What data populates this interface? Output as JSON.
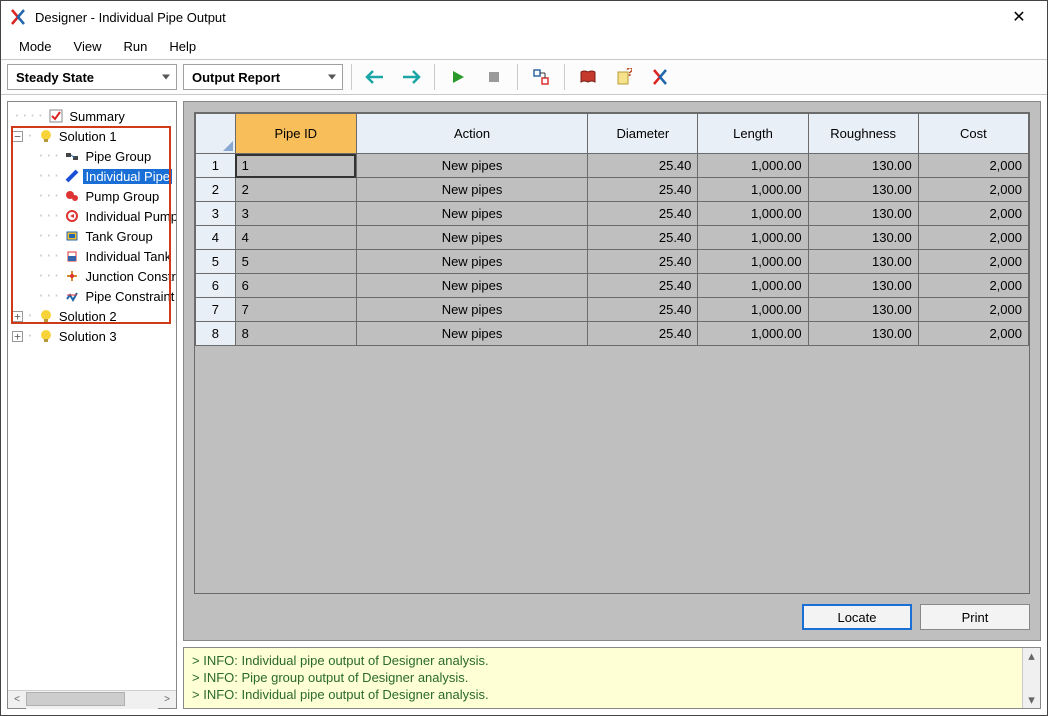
{
  "window": {
    "title": "Designer - Individual Pipe Output"
  },
  "menu": {
    "items": [
      "Mode",
      "View",
      "Run",
      "Help"
    ]
  },
  "toolbar": {
    "mode_combo": "Steady State",
    "report_combo": "Output Report"
  },
  "tree": {
    "summary": "Summary",
    "solution1": "Solution 1",
    "solution2": "Solution 2",
    "solution3": "Solution 3",
    "children": {
      "pipe_group": "Pipe Group",
      "individual_pipe": "Individual Pipe",
      "pump_group": "Pump Group",
      "individual_pump": "Individual Pump",
      "tank_group": "Tank Group",
      "individual_tank": "Individual Tank",
      "junction_con": "Junction Constraint",
      "pipe_constraint": "Pipe Constraint"
    }
  },
  "table": {
    "headers": {
      "pipe_id": "Pipe ID",
      "action": "Action",
      "diameter": "Diameter",
      "length": "Length",
      "roughness": "Roughness",
      "cost": "Cost"
    },
    "rows": [
      {
        "n": "1",
        "id": "1",
        "action": "New pipes",
        "diameter": "25.40",
        "length": "1,000.00",
        "roughness": "130.00",
        "cost": "2,000"
      },
      {
        "n": "2",
        "id": "2",
        "action": "New pipes",
        "diameter": "25.40",
        "length": "1,000.00",
        "roughness": "130.00",
        "cost": "2,000"
      },
      {
        "n": "3",
        "id": "3",
        "action": "New pipes",
        "diameter": "25.40",
        "length": "1,000.00",
        "roughness": "130.00",
        "cost": "2,000"
      },
      {
        "n": "4",
        "id": "4",
        "action": "New pipes",
        "diameter": "25.40",
        "length": "1,000.00",
        "roughness": "130.00",
        "cost": "2,000"
      },
      {
        "n": "5",
        "id": "5",
        "action": "New pipes",
        "diameter": "25.40",
        "length": "1,000.00",
        "roughness": "130.00",
        "cost": "2,000"
      },
      {
        "n": "6",
        "id": "6",
        "action": "New pipes",
        "diameter": "25.40",
        "length": "1,000.00",
        "roughness": "130.00",
        "cost": "2,000"
      },
      {
        "n": "7",
        "id": "7",
        "action": "New pipes",
        "diameter": "25.40",
        "length": "1,000.00",
        "roughness": "130.00",
        "cost": "2,000"
      },
      {
        "n": "8",
        "id": "8",
        "action": "New pipes",
        "diameter": "25.40",
        "length": "1,000.00",
        "roughness": "130.00",
        "cost": "2,000"
      }
    ]
  },
  "buttons": {
    "locate": "Locate",
    "print": "Print"
  },
  "log": {
    "lines": [
      "> INFO: Individual pipe output of Designer analysis.",
      "> INFO: Pipe group output of Designer analysis.",
      "> INFO: Individual pipe output of Designer analysis."
    ]
  }
}
